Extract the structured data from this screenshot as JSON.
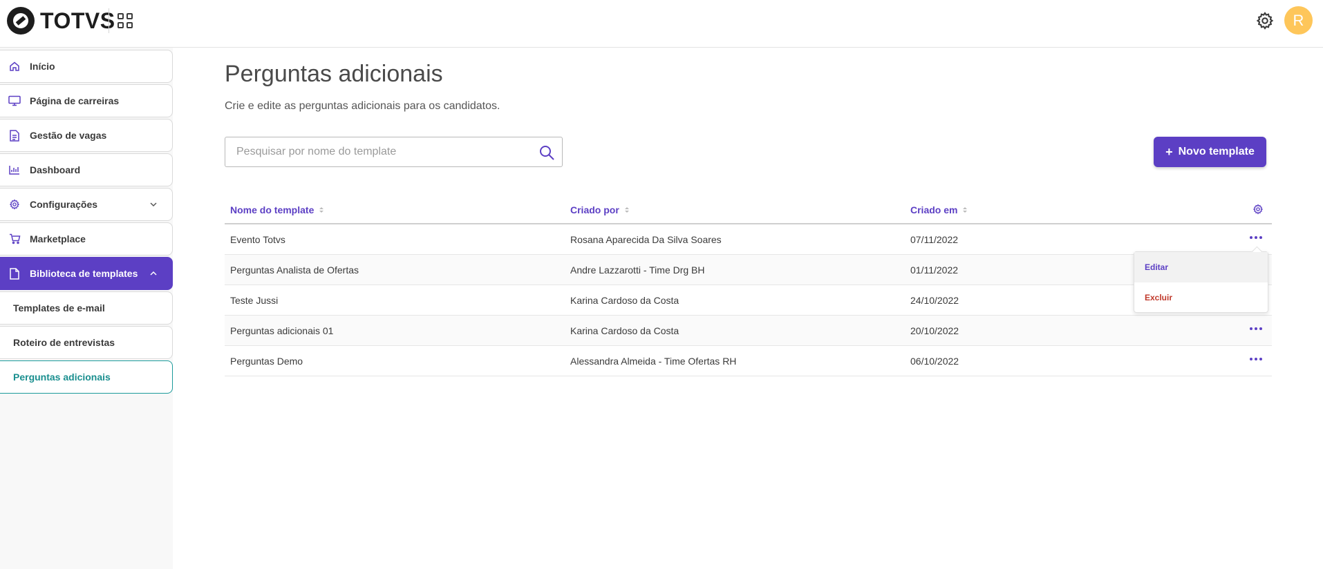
{
  "header": {
    "brand": "TOTVS",
    "avatar_initial": "R"
  },
  "sidebar": {
    "items": [
      {
        "label": "Início",
        "icon": "home-icon"
      },
      {
        "label": "Página de carreiras",
        "icon": "monitor-icon"
      },
      {
        "label": "Gestão de vagas",
        "icon": "document-icon"
      },
      {
        "label": "Dashboard",
        "icon": "bar-chart-icon"
      },
      {
        "label": "Configurações",
        "icon": "gear-icon"
      },
      {
        "label": "Marketplace",
        "icon": "cart-icon"
      },
      {
        "label": "Biblioteca de templates",
        "icon": "file-icon"
      }
    ],
    "subitems": [
      {
        "label": "Templates de e-mail"
      },
      {
        "label": "Roteiro de entrevistas"
      },
      {
        "label": "Perguntas adicionais"
      }
    ]
  },
  "main": {
    "title": "Perguntas adicionais",
    "subtitle": "Crie e edite as perguntas adicionais para os candidatos.",
    "search_placeholder": "Pesquisar por nome do template",
    "new_button": "Novo template",
    "new_button_icon": "+"
  },
  "table": {
    "columns": [
      "Nome do template",
      "Criado por",
      "Criado em"
    ],
    "rows": [
      {
        "name": "Evento Totvs",
        "author": "Rosana Aparecida Da Silva Soares",
        "date": "07/11/2022"
      },
      {
        "name": "Perguntas Analista de Ofertas",
        "author": "Andre Lazzarotti - Time Drg BH",
        "date": "01/11/2022"
      },
      {
        "name": "Teste Jussi",
        "author": "Karina Cardoso da Costa",
        "date": "24/10/2022"
      },
      {
        "name": "Perguntas adicionais 01",
        "author": "Karina Cardoso da Costa",
        "date": "20/10/2022"
      },
      {
        "name": "Perguntas Demo",
        "author": "Alessandra Almeida - Time Ofertas RH",
        "date": "06/10/2022"
      }
    ]
  },
  "menu": {
    "edit": "Editar",
    "delete": "Excluir"
  },
  "colors": {
    "primary": "#5c3fc4",
    "accent_teal": "#1a9a9a",
    "danger": "#c0392b",
    "avatar": "#fec65a"
  }
}
